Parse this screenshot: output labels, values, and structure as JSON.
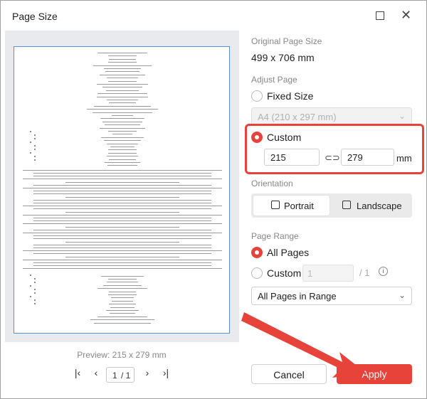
{
  "window": {
    "title": "Page Size",
    "maximize_icon": "maximize-icon",
    "close_icon": "close-icon"
  },
  "preview": {
    "label": "Preview: 215 x 279 mm",
    "pager": {
      "current": "1",
      "total": "/ 1"
    }
  },
  "original": {
    "label": "Original Page Size",
    "value": "499 x 706 mm"
  },
  "adjust": {
    "label": "Adjust Page",
    "fixed_label": "Fixed Size",
    "fixed_select": "A4 (210 x 297 mm)",
    "custom_label": "Custom",
    "width": "215",
    "height": "279",
    "unit": "mm"
  },
  "orientation": {
    "label": "Orientation",
    "portrait": "Portrait",
    "landscape": "Landscape"
  },
  "range": {
    "label": "Page Range",
    "all_label": "All Pages",
    "custom_label": "Custom",
    "from": "1",
    "sep": "/",
    "total": "1",
    "subset": "All Pages in Range"
  },
  "buttons": {
    "cancel": "Cancel",
    "apply": "Apply"
  },
  "colors": {
    "accent": "#e8433a",
    "preview_border": "#5b8fe0"
  }
}
